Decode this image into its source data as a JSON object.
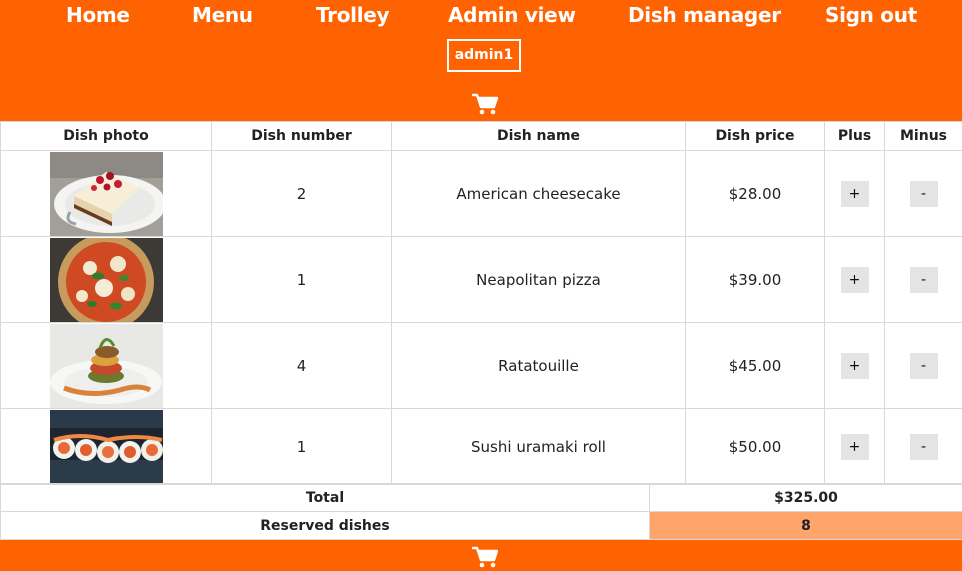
{
  "nav": {
    "home": "Home",
    "menu": "Menu",
    "trolley": "Trolley",
    "admin_view": "Admin view",
    "dish_manager": "Dish manager",
    "sign_out": "Sign out"
  },
  "user": {
    "name": "admin1"
  },
  "icons": {
    "cart": "shopping-cart-icon"
  },
  "colors": {
    "brand": "#ff6200",
    "highlight": "#ffa46b",
    "button": "#e4e4e4"
  },
  "table": {
    "headers": {
      "photo": "Dish photo",
      "number": "Dish number",
      "name": "Dish name",
      "price": "Dish price",
      "plus": "Plus",
      "minus": "Minus"
    },
    "rows": [
      {
        "photo": "American cheesecake photo",
        "number": "2",
        "name": "American cheesecake",
        "price": "$28.00",
        "plus": "+",
        "minus": "-"
      },
      {
        "photo": "Neapolitan pizza photo",
        "number": "1",
        "name": "Neapolitan pizza",
        "price": "$39.00",
        "plus": "+",
        "minus": "-"
      },
      {
        "photo": "Ratatouille photo",
        "number": "4",
        "name": "Ratatouille",
        "price": "$45.00",
        "plus": "+",
        "minus": "-"
      },
      {
        "photo": "Sushi uramaki roll photo",
        "number": "1",
        "name": "Sushi uramaki roll",
        "price": "$50.00",
        "plus": "+",
        "minus": "-"
      }
    ]
  },
  "summary": {
    "total_label": "Total",
    "total_value": "$325.00",
    "reserved_label": "Reserved dishes",
    "reserved_value": "8"
  }
}
